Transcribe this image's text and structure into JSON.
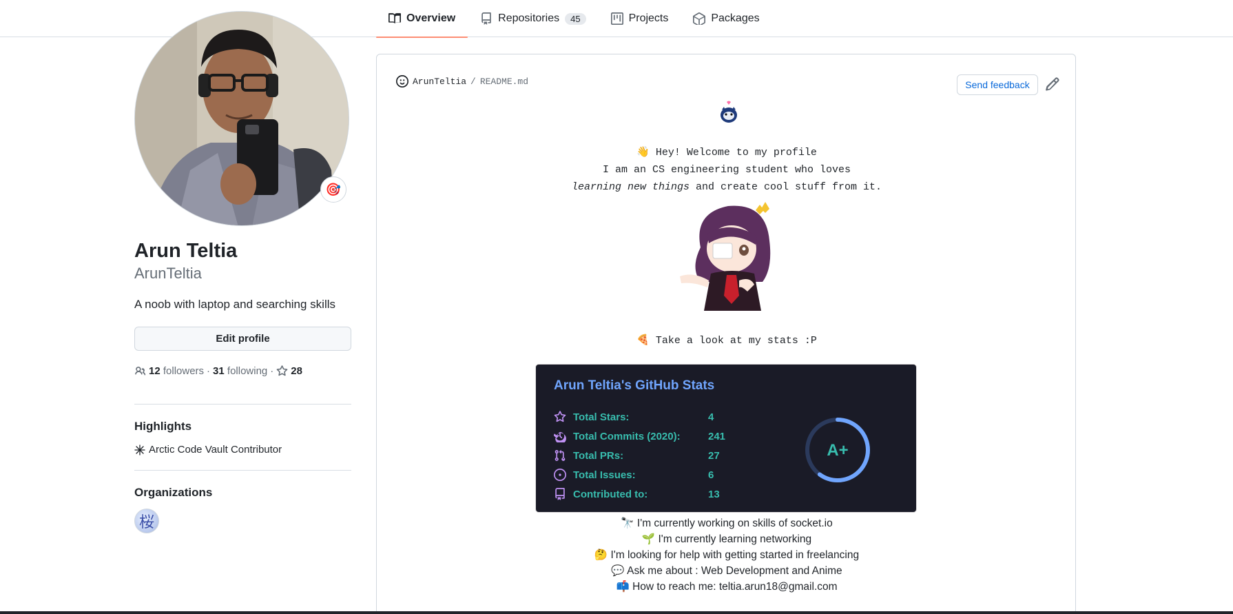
{
  "tabs": [
    {
      "label": "Overview",
      "icon": "book-icon",
      "active": true
    },
    {
      "label": "Repositories",
      "icon": "repo-icon",
      "count": "45"
    },
    {
      "label": "Projects",
      "icon": "project-icon"
    },
    {
      "label": "Packages",
      "icon": "package-icon"
    }
  ],
  "profile": {
    "name": "Arun Teltia",
    "login": "ArunTeltia",
    "bio": "A noob with laptop and searching skills",
    "edit_label": "Edit profile",
    "followers_count": "12",
    "followers_label": "followers",
    "sep": "·",
    "following_count": "31",
    "following_label": "following",
    "stars_count": "28",
    "status_emoji": "🎯"
  },
  "highlights": {
    "heading": "Highlights",
    "items": [
      "Arctic Code Vault Contributor"
    ]
  },
  "organizations": {
    "heading": "Organizations",
    "avatar_glyph": "桜"
  },
  "readme": {
    "path_user": "ArunTeltia",
    "path_sep": "/",
    "path_file": "README.md",
    "feedback_label": "Send feedback",
    "intro": [
      "👋 Hey! Welcome to my profile",
      "I am an CS engineering student who loves",
      "learning new things and create cool stuff from it."
    ],
    "intro_em": "learning new things",
    "intro_rest": " and create cool stuff from it.",
    "stats_line": "🍕 Take a look at my stats :P",
    "bullets": [
      {
        "emoji": "🔭",
        "text": "I'm currently working on skills of socket.io"
      },
      {
        "emoji": "🌱",
        "text": "I'm currently learning networking"
      },
      {
        "emoji": "🤔",
        "text": "I'm looking for help with getting started in freelancing"
      },
      {
        "emoji": "💬",
        "text": "Ask me about : Web Development and Anime"
      },
      {
        "emoji": "📫",
        "text": "How to reach me: teltia.arun18@gmail.com"
      }
    ]
  },
  "stats_card": {
    "title": "Arun Teltia's GitHub Stats",
    "rows": [
      {
        "label": "Total Stars:",
        "value": "4",
        "icon": "star-icon"
      },
      {
        "label": "Total Commits (2020):",
        "value": "241",
        "icon": "history-icon"
      },
      {
        "label": "Total PRs:",
        "value": "27",
        "icon": "pull-request-icon"
      },
      {
        "label": "Total Issues:",
        "value": "6",
        "icon": "issue-icon"
      },
      {
        "label": "Contributed to:",
        "value": "13",
        "icon": "repo-icon"
      }
    ],
    "rank": "A+",
    "rank_progress": 0.6,
    "colors": {
      "bg": "#1a1b27",
      "title": "#70a5fd",
      "text": "#38bdae",
      "icon": "#bf91f3",
      "ring": "#70a5fd"
    }
  }
}
